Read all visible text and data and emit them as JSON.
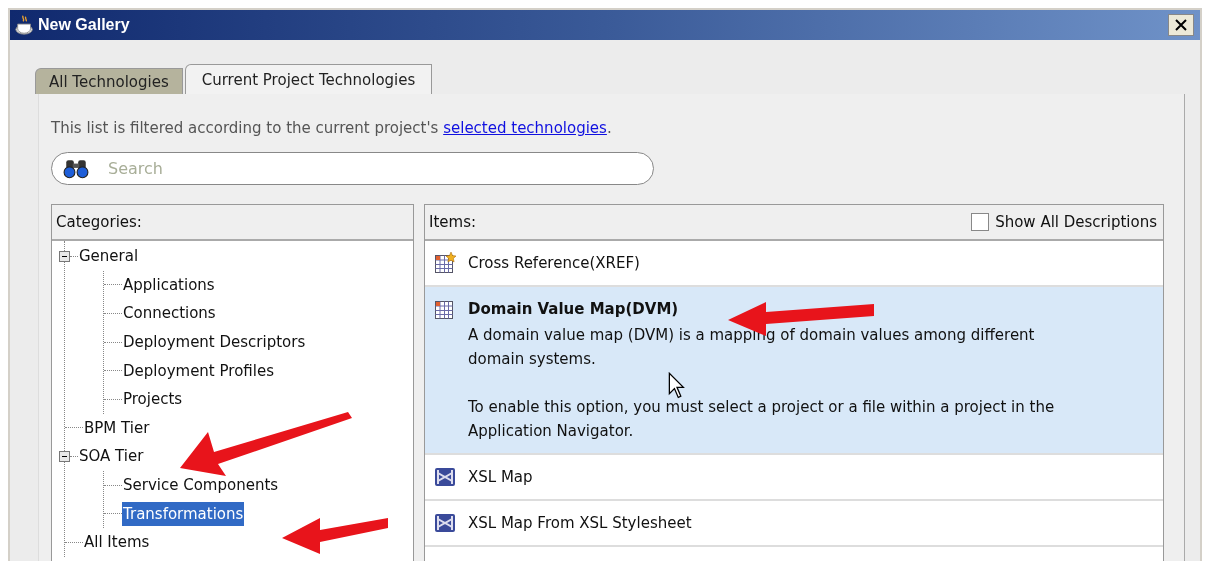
{
  "window": {
    "title": "New Gallery"
  },
  "tabs": [
    {
      "label": "All Technologies",
      "selected": false
    },
    {
      "label": "Current Project Technologies",
      "selected": true
    }
  ],
  "filter_note": {
    "text": "This list is filtered according to the current project's ",
    "link": "selected technologies",
    "end": "."
  },
  "search": {
    "placeholder": "Search"
  },
  "categories": {
    "label": "Categories:",
    "tree": [
      {
        "label": "General",
        "expanded": true,
        "selected": false,
        "children": [
          {
            "label": "Applications",
            "selected": false
          },
          {
            "label": "Connections",
            "selected": false
          },
          {
            "label": "Deployment Descriptors",
            "selected": false
          },
          {
            "label": "Deployment Profiles",
            "selected": false
          },
          {
            "label": "Projects",
            "selected": false
          }
        ]
      },
      {
        "label": "BPM Tier",
        "selected": false
      },
      {
        "label": "SOA Tier",
        "expanded": true,
        "selected": false,
        "children": [
          {
            "label": "Service Components",
            "selected": false
          },
          {
            "label": "Transformations",
            "selected": true
          }
        ]
      },
      {
        "label": "All Items",
        "selected": false
      }
    ]
  },
  "items": {
    "label": "Items:",
    "show_all_descriptions": {
      "label": "Show All Descriptions",
      "checked": false
    },
    "list": [
      {
        "name": "Cross Reference(XREF)",
        "kind": "grid-star",
        "selected": false
      },
      {
        "name": "Domain Value Map(DVM)",
        "kind": "grid",
        "selected": true,
        "description": [
          "A domain value map (DVM) is a mapping of domain values among different domain systems.",
          "To enable this option, you must select a project or a file within a project in the Application Navigator."
        ]
      },
      {
        "name": "XSL Map",
        "kind": "xsl-map",
        "selected": false
      },
      {
        "name": "XSL Map From XSL Stylesheet",
        "kind": "xsl-map",
        "selected": false
      }
    ]
  }
}
